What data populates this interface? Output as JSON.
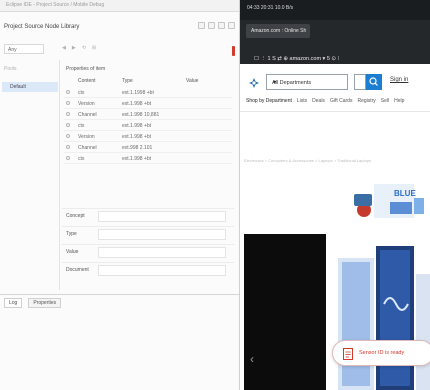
{
  "left_window": {
    "title_bar": "Eclipse IDE - Project Source / Mobile Debug",
    "view_title": "Project Source Node Library",
    "filter_value": "Any",
    "nav_icons": [
      "◀",
      "▶",
      "⟲",
      "⊞"
    ],
    "tree_header": "Pools",
    "tree_selected": "Default",
    "table_caption": "Properties of item",
    "table": {
      "columns": [
        "Content",
        "Type",
        "Value"
      ],
      "rows": [
        [
          "ctx",
          "ext.1.1998 +bt",
          ""
        ],
        [
          "Version",
          "ext.1.998 +bt",
          ""
        ],
        [
          "Channel",
          "ext.1.998 10,881",
          ""
        ],
        [
          "ctx",
          "ext.1.998 +bt",
          ""
        ],
        [
          "Version",
          "ext.1.998 +bt",
          ""
        ],
        [
          "Channel",
          "ext.998 2.101",
          ""
        ],
        [
          "ctx",
          "ext.1.998 +bt",
          ""
        ]
      ]
    },
    "form": {
      "fields": [
        {
          "label": "Concept"
        },
        {
          "label": "Type"
        },
        {
          "label": "Value"
        },
        {
          "label": "Document"
        }
      ]
    },
    "bottom_tabs": [
      "Log",
      "Properties"
    ]
  },
  "right_window": {
    "status_text": "04:33   20:31   10.0 B/s",
    "tab_title": "Amazon.com : Online Sh",
    "url_text": "☐  ⋮  1 S  ⇄  ⊕  amazon.com  ▾  5  ⊙  ⁞",
    "search_category": "All Departments",
    "account_link": "Sign in",
    "nav_links": [
      "Shop by Department",
      "Lists",
      "Deals",
      "Gift Cards",
      "Registry",
      "Sell",
      "Help"
    ],
    "breadcrumb": "Electronics > Computers & Accessories > Laptops > Traditional Laptops",
    "toast_text": "Sensor ID is ready",
    "colors": {
      "status_bar": "#1a1d1f",
      "search_button": "#1b7ed1",
      "toast_accent": "#d2372c"
    }
  }
}
